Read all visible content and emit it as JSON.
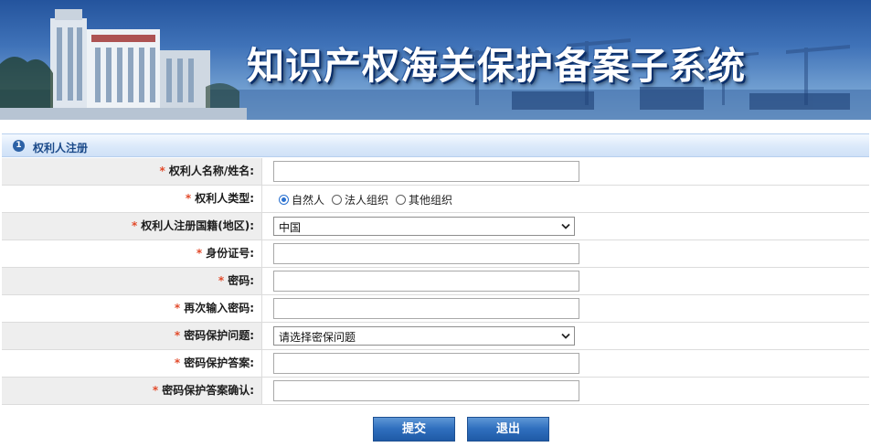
{
  "header": {
    "title": "知识产权海关保护备案子系统"
  },
  "section": {
    "step": "1",
    "title": "权利人注册"
  },
  "form": {
    "required_mark": "*",
    "name": {
      "label": "权利人名称/姓名:",
      "value": ""
    },
    "type": {
      "label": "权利人类型:",
      "options": [
        "自然人",
        "法人组织",
        "其他组织"
      ],
      "selected": "自然人"
    },
    "country": {
      "label": "权利人注册国籍(地区):",
      "value": "中国"
    },
    "id_number": {
      "label": "身份证号:",
      "value": ""
    },
    "password": {
      "label": "密码:",
      "value": ""
    },
    "password_confirm": {
      "label": "再次输入密码:",
      "value": ""
    },
    "security_question": {
      "label": "密码保护问题:",
      "value": "请选择密保问题"
    },
    "security_answer": {
      "label": "密码保护答案:",
      "value": ""
    },
    "security_answer_confirm": {
      "label": "密码保护答案确认:",
      "value": ""
    }
  },
  "buttons": {
    "submit": "提交",
    "exit": "退出"
  }
}
